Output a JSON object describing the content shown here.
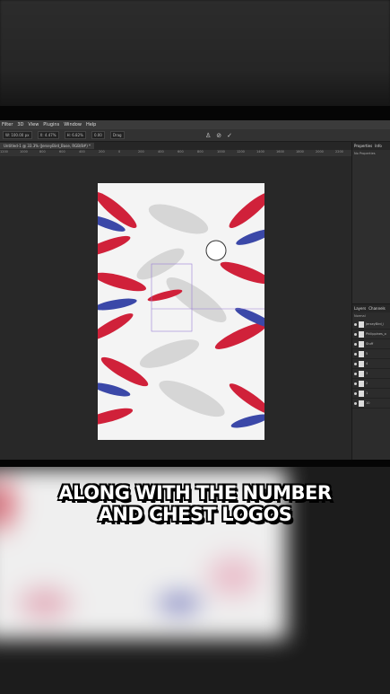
{
  "menu": [
    "Filter",
    "3D",
    "View",
    "Plugins",
    "Window",
    "Help"
  ],
  "options": [
    "W: 100.00 px",
    "X: 4.47%",
    "H: 6.82%",
    "0.00",
    "Drag"
  ],
  "tabs": [
    "Untitled-1 @ 33.3% (JerseyBird_Base, RGB/8#) *"
  ],
  "ruler": [
    "1200",
    "1000",
    "800",
    "600",
    "400",
    "200",
    "0",
    "200",
    "400",
    "600",
    "800",
    "1000",
    "1200",
    "1400",
    "1600",
    "1800",
    "2000",
    "2200"
  ],
  "right_panel": {
    "tabs": [
      "Properties",
      "Info"
    ],
    "text": "No Properties",
    "layers_tabs": [
      "Layers",
      "Channels"
    ],
    "blend": "Normal",
    "layers": [
      "JerseyBird_i",
      "Philippines_o",
      "Stuff",
      "5",
      "4",
      "3",
      "2",
      "1",
      "10"
    ]
  },
  "caption": {
    "line1": "ALONG WITH THE NUMBER",
    "line2": "AND CHEST LOGOS"
  },
  "colors": {
    "red": "#d0213a",
    "blue": "#3b48a8",
    "gray": "#bdbdbd"
  }
}
